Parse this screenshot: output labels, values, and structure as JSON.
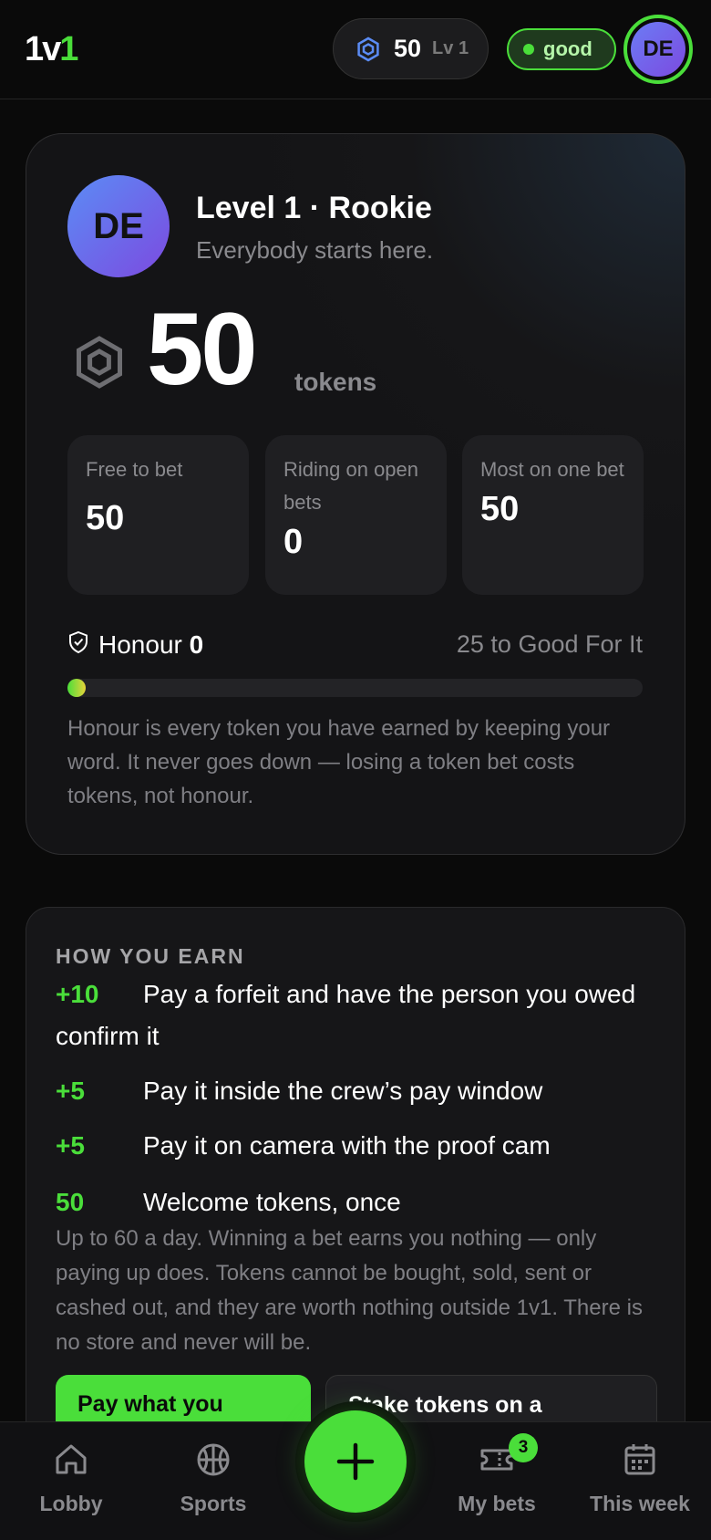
{
  "header": {
    "logo_main": "1v",
    "logo_accent": "1",
    "tokens": "50",
    "level": "Lv 1",
    "status": "good",
    "avatar_initials": "DE"
  },
  "level_card": {
    "avatar_initials": "DE",
    "title": "Level 1 · Rookie",
    "subtitle": "Everybody starts here.",
    "tokens_value": "50",
    "tokens_unit": "tokens",
    "stats": [
      {
        "label": "Free to bet",
        "value": "50"
      },
      {
        "label": "Riding on open bets",
        "value": "0"
      },
      {
        "label": "Most on one bet",
        "value": "50"
      }
    ],
    "honour_label": "Honour",
    "honour_value": "0",
    "honour_target": "25 to Good For It",
    "honour_progress_fraction": 0,
    "honour_note": "Honour is every token you have earned by keeping your word. It never goes down — losing a token bet costs tokens, not honour."
  },
  "earn_card": {
    "heading": "HOW YOU EARN",
    "rows": [
      {
        "amount": "+10",
        "text": "Pay a forfeit and have the person you owed confirm it"
      },
      {
        "amount": "+5",
        "text": "Pay it inside the crew’s pay window"
      },
      {
        "amount": "+5",
        "text": "Pay it on camera with the proof cam"
      },
      {
        "amount": "50",
        "text": "Welcome tokens, once"
      }
    ],
    "note": "Up to 60 a day. Winning a bet earns you nothing — only paying up does. Tokens cannot be bought, sold, sent or cashed out, and they are worth nothing outside 1v1. There is no store and never will be.",
    "cta_primary": "Pay what you",
    "cta_secondary": "Stake tokens on a"
  },
  "bottom_nav": {
    "lobby": "Lobby",
    "sports": "Sports",
    "my_bets": "My bets",
    "my_bets_badge": "3",
    "this_week": "This week"
  },
  "colors": {
    "accent": "#4ade3a",
    "background": "#0a0a0a",
    "card": "#161618",
    "muted_text": "#8a8a8e"
  }
}
